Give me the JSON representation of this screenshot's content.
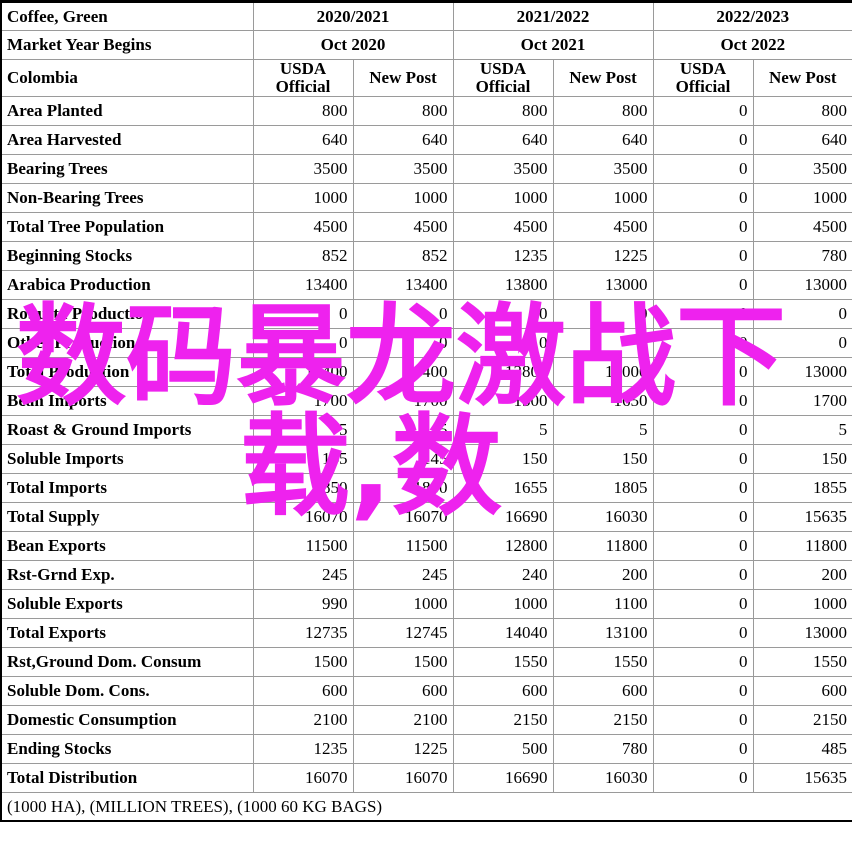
{
  "table": {
    "corner": {
      "line1": "Coffee, Green",
      "line2": "Market Year Begins",
      "line3": "Colombia"
    },
    "years": [
      "2020/2021",
      "2021/2022",
      "2022/2023"
    ],
    "months": [
      "Oct 2020",
      "Oct 2021",
      "Oct 2022"
    ],
    "sources": [
      "USDA Official",
      "New Post",
      "USDA Official",
      "New Post",
      "USDA Official",
      "New Post"
    ],
    "source_labels": {
      "usda_l1": "USDA",
      "usda_l2": "Official",
      "newpost": "New Post"
    },
    "units": "(1000 HA), (MILLION TREES), (1000 60 KG BAGS)",
    "rows": [
      {
        "label": "Area Planted",
        "values": [
          "800",
          "800",
          "800",
          "800",
          "0",
          "800"
        ]
      },
      {
        "label": "Area Harvested",
        "values": [
          "640",
          "640",
          "640",
          "640",
          "0",
          "640"
        ]
      },
      {
        "label": "Bearing Trees",
        "values": [
          "3500",
          "3500",
          "3500",
          "3500",
          "0",
          "3500"
        ]
      },
      {
        "label": "Non-Bearing Trees",
        "values": [
          "1000",
          "1000",
          "1000",
          "1000",
          "0",
          "1000"
        ]
      },
      {
        "label": "Total Tree Population",
        "values": [
          "4500",
          "4500",
          "4500",
          "4500",
          "0",
          "4500"
        ]
      },
      {
        "label": "Beginning Stocks",
        "values": [
          "852",
          "852",
          "1235",
          "1225",
          "0",
          "780"
        ]
      },
      {
        "label": "Arabica Production",
        "values": [
          "13400",
          "13400",
          "13800",
          "13000",
          "0",
          "13000"
        ]
      },
      {
        "label": "Robusta Production",
        "values": [
          "0",
          "0",
          "0",
          "0",
          "0",
          "0"
        ]
      },
      {
        "label": "Other Production",
        "values": [
          "0",
          "0",
          "0",
          "0",
          "0",
          "0"
        ]
      },
      {
        "label": "Total Production",
        "values": [
          "13400",
          "13400",
          "13800",
          "13000",
          "0",
          "13000"
        ]
      },
      {
        "label": "Bean Imports",
        "values": [
          "1700",
          "1700",
          "1500",
          "1650",
          "0",
          "1700"
        ]
      },
      {
        "label": "Roast & Ground Imports",
        "values": [
          "5",
          "5",
          "5",
          "5",
          "0",
          "5"
        ]
      },
      {
        "label": "Soluble Imports",
        "values": [
          "145",
          "145",
          "150",
          "150",
          "0",
          "150"
        ]
      },
      {
        "label": "Total Imports",
        "values": [
          "1850",
          "1850",
          "1655",
          "1805",
          "0",
          "1855"
        ]
      },
      {
        "label": "Total Supply",
        "values": [
          "16070",
          "16070",
          "16690",
          "16030",
          "0",
          "15635"
        ]
      },
      {
        "label": "Bean Exports",
        "values": [
          "11500",
          "11500",
          "12800",
          "11800",
          "0",
          "11800"
        ]
      },
      {
        "label": "Rst-Grnd Exp.",
        "values": [
          "245",
          "245",
          "240",
          "200",
          "0",
          "200"
        ]
      },
      {
        "label": "Soluble Exports",
        "values": [
          "990",
          "1000",
          "1000",
          "1100",
          "0",
          "1000"
        ]
      },
      {
        "label": "Total Exports",
        "values": [
          "12735",
          "12745",
          "14040",
          "13100",
          "0",
          "13000"
        ]
      },
      {
        "label": "Rst,Ground Dom. Consum",
        "values": [
          "1500",
          "1500",
          "1550",
          "1550",
          "0",
          "1550"
        ]
      },
      {
        "label": "Soluble Dom. Cons.",
        "values": [
          "600",
          "600",
          "600",
          "600",
          "0",
          "600"
        ]
      },
      {
        "label": "Domestic Consumption",
        "values": [
          "2100",
          "2100",
          "2150",
          "2150",
          "0",
          "2150"
        ]
      },
      {
        "label": "Ending Stocks",
        "values": [
          "1235",
          "1225",
          "500",
          "780",
          "0",
          "485"
        ]
      },
      {
        "label": "Total Distribution",
        "values": [
          "16070",
          "16070",
          "16690",
          "16030",
          "0",
          "15635"
        ]
      }
    ]
  },
  "watermark": {
    "line1": "数码暴龙激战下",
    "line2": "载,数",
    "color": "#ee22ee"
  }
}
